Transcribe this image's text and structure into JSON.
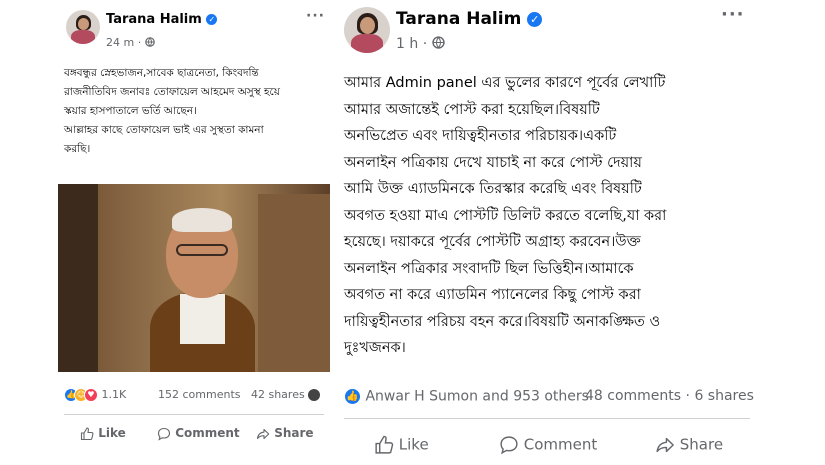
{
  "post1": {
    "author": "Tarana Halim",
    "time": "24 m",
    "text_lines": [
      "বঙ্গবন্ধুর স্নেহভাজন,সাবেক ছাত্রনেতা, কিংবদন্তি",
      "রাজনীতিবিদ জনাবঃ তোফায়েল আহমেদ অসুস্থ হয়ে",
      "স্কয়ার হাসপাতালে ভর্তি আছেন।",
      "আল্লাহর কাছে তোফায়েল ভাই এর সুস্থতা কামনা",
      "করছি।"
    ],
    "reactions_count": "1.1K",
    "comments": "152 comments",
    "shares": "42 shares",
    "actions": {
      "like": "Like",
      "comment": "Comment",
      "share": "Share"
    }
  },
  "post2": {
    "author": "Tarana Halim",
    "time": "1 h",
    "text_lines": [
      "আমার Admin panel এর ভুলের কারণে পূর্বের লেখাটি",
      "আমার অজান্তেই পোস্ট করা হয়েছিল।বিষয়টি",
      "অনভিপ্রেত এবং দায়িত্বহীনতার পরিচায়ক।একটি",
      "অনলাইন পত্রিকায় দেখে যাচাই না করে পোস্ট দেয়ায়",
      "আমি উক্ত এ্যাডমিনকে তিরস্কার করেছি এবং বিষয়টি",
      "অবগত হওয়া মাএ পোস্টটি ডিলিট করতে বলেছি,যা করা",
      "হয়েছে।  দয়াকরে পূর্বের পোস্টটি অগ্রাহ্য করবেন।উক্ত",
      "অনলাইন পত্রিকার সংবাদটি ছিল ভিত্তিহীন।আমাকে",
      "অবগত না করে এ্যাডমিন প্যানেলের কিছু পোস্ট করা",
      "দায়িত্বহীনতার পরিচয় বহন করে।বিষয়টি অনাকঙ্ক্ষিত ও",
      "দুঃখজনক।"
    ],
    "reactions_text": "Anwar H Sumon and 953 others",
    "comments": "48 comments",
    "shares": "6 shares",
    "actions": {
      "like": "Like",
      "comment": "Comment",
      "share": "Share"
    }
  },
  "icons": {
    "verified": "verified-badge-icon",
    "globe": "globe-icon",
    "more": "more-options-icon",
    "like": "thumbs-up-icon",
    "comment": "speech-bubble-icon",
    "share": "share-arrow-icon"
  },
  "colors": {
    "facebook_blue": "#1877f2",
    "secondary_text": "#65676b",
    "like_blue": "#1877f2",
    "love_red": "#f33e58",
    "haha_yellow": "#f7b125"
  }
}
